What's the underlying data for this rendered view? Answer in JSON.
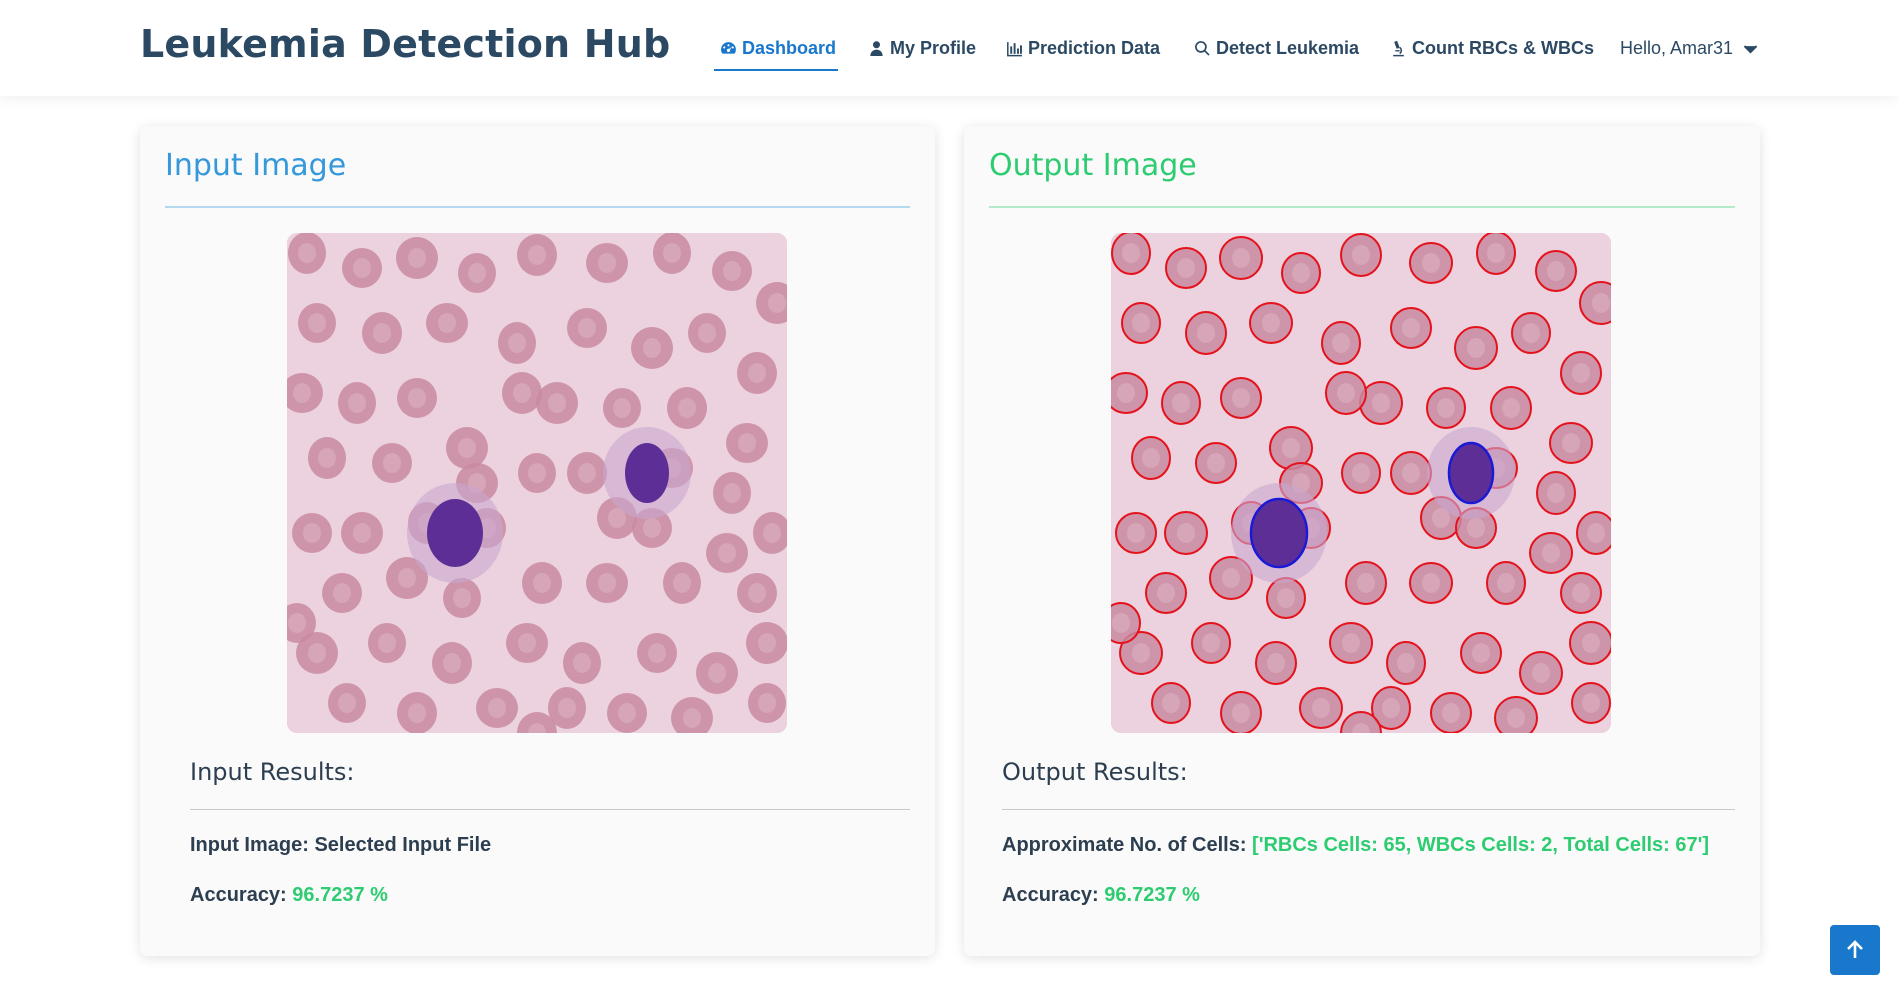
{
  "header": {
    "brand": "Leukemia Detection Hub",
    "nav": [
      {
        "label": "Dashboard",
        "icon": "dashboard-icon",
        "active": true
      },
      {
        "label": "My Profile",
        "icon": "user-icon"
      },
      {
        "label": "Prediction Data",
        "icon": "bar-chart-icon"
      },
      {
        "label": "Detect Leukemia",
        "icon": "search-icon"
      },
      {
        "label": "Count RBCs & WBCs",
        "icon": "microscope-icon"
      }
    ],
    "user_menu": "Hello, Amar31"
  },
  "input_card": {
    "title": "Input Image",
    "results_title": "Input Results:",
    "line1_label": "Input Image: ",
    "line1_value": "Selected Input File",
    "accuracy_label": "Accuracy: ",
    "accuracy_value": "96.7237 %"
  },
  "output_card": {
    "title": "Output Image",
    "results_title": "Output Results:",
    "line1_label": "Approximate No. of Cells: ",
    "line1_value": "['RBCs Cells: 65, WBCs Cells: 2, Total Cells: 67']",
    "accuracy_label": "Accuracy: ",
    "accuracy_value": "96.7237 %"
  },
  "colors": {
    "brand": "#2c4964",
    "active_nav": "#1977cc",
    "input_title": "#3498db",
    "output_title": "#2ecc71",
    "value_green": "#2ecc71",
    "rbc_outline": "#e5121b",
    "wbc_outline": "#1a1ad6"
  }
}
